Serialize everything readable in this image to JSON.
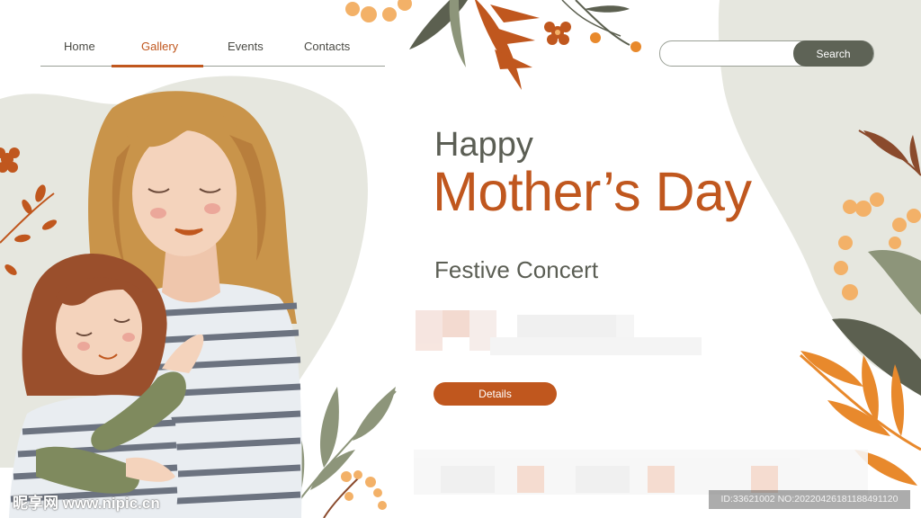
{
  "nav": {
    "items": [
      "Home",
      "Gallery",
      "Events",
      "Contacts"
    ],
    "active_item": "Gallery"
  },
  "search": {
    "placeholder": "",
    "button_label": "Search"
  },
  "hero": {
    "title_small": "Happy",
    "title_large": "Mother’s Day",
    "subtitle": "Festive Concert",
    "details_button": "Details"
  },
  "watermark": {
    "logo_text": "昵享网 www.nipic.cn",
    "id_text": "ID:33621002 NO:20220426181188491120"
  },
  "colors": {
    "accent": "#c0571e",
    "dark_text": "#5b5e54",
    "sage": "#e6e7df",
    "button_dark": "#5e6356",
    "leaf_olive": "#8d957a",
    "leaf_dark": "#5c6050",
    "leaf_orange": "#e8892c"
  },
  "icons": [
    "flower-icon",
    "leaf-branch-icon",
    "berry-branch-icon"
  ],
  "illustration": "mother-and-daughter-illustration"
}
